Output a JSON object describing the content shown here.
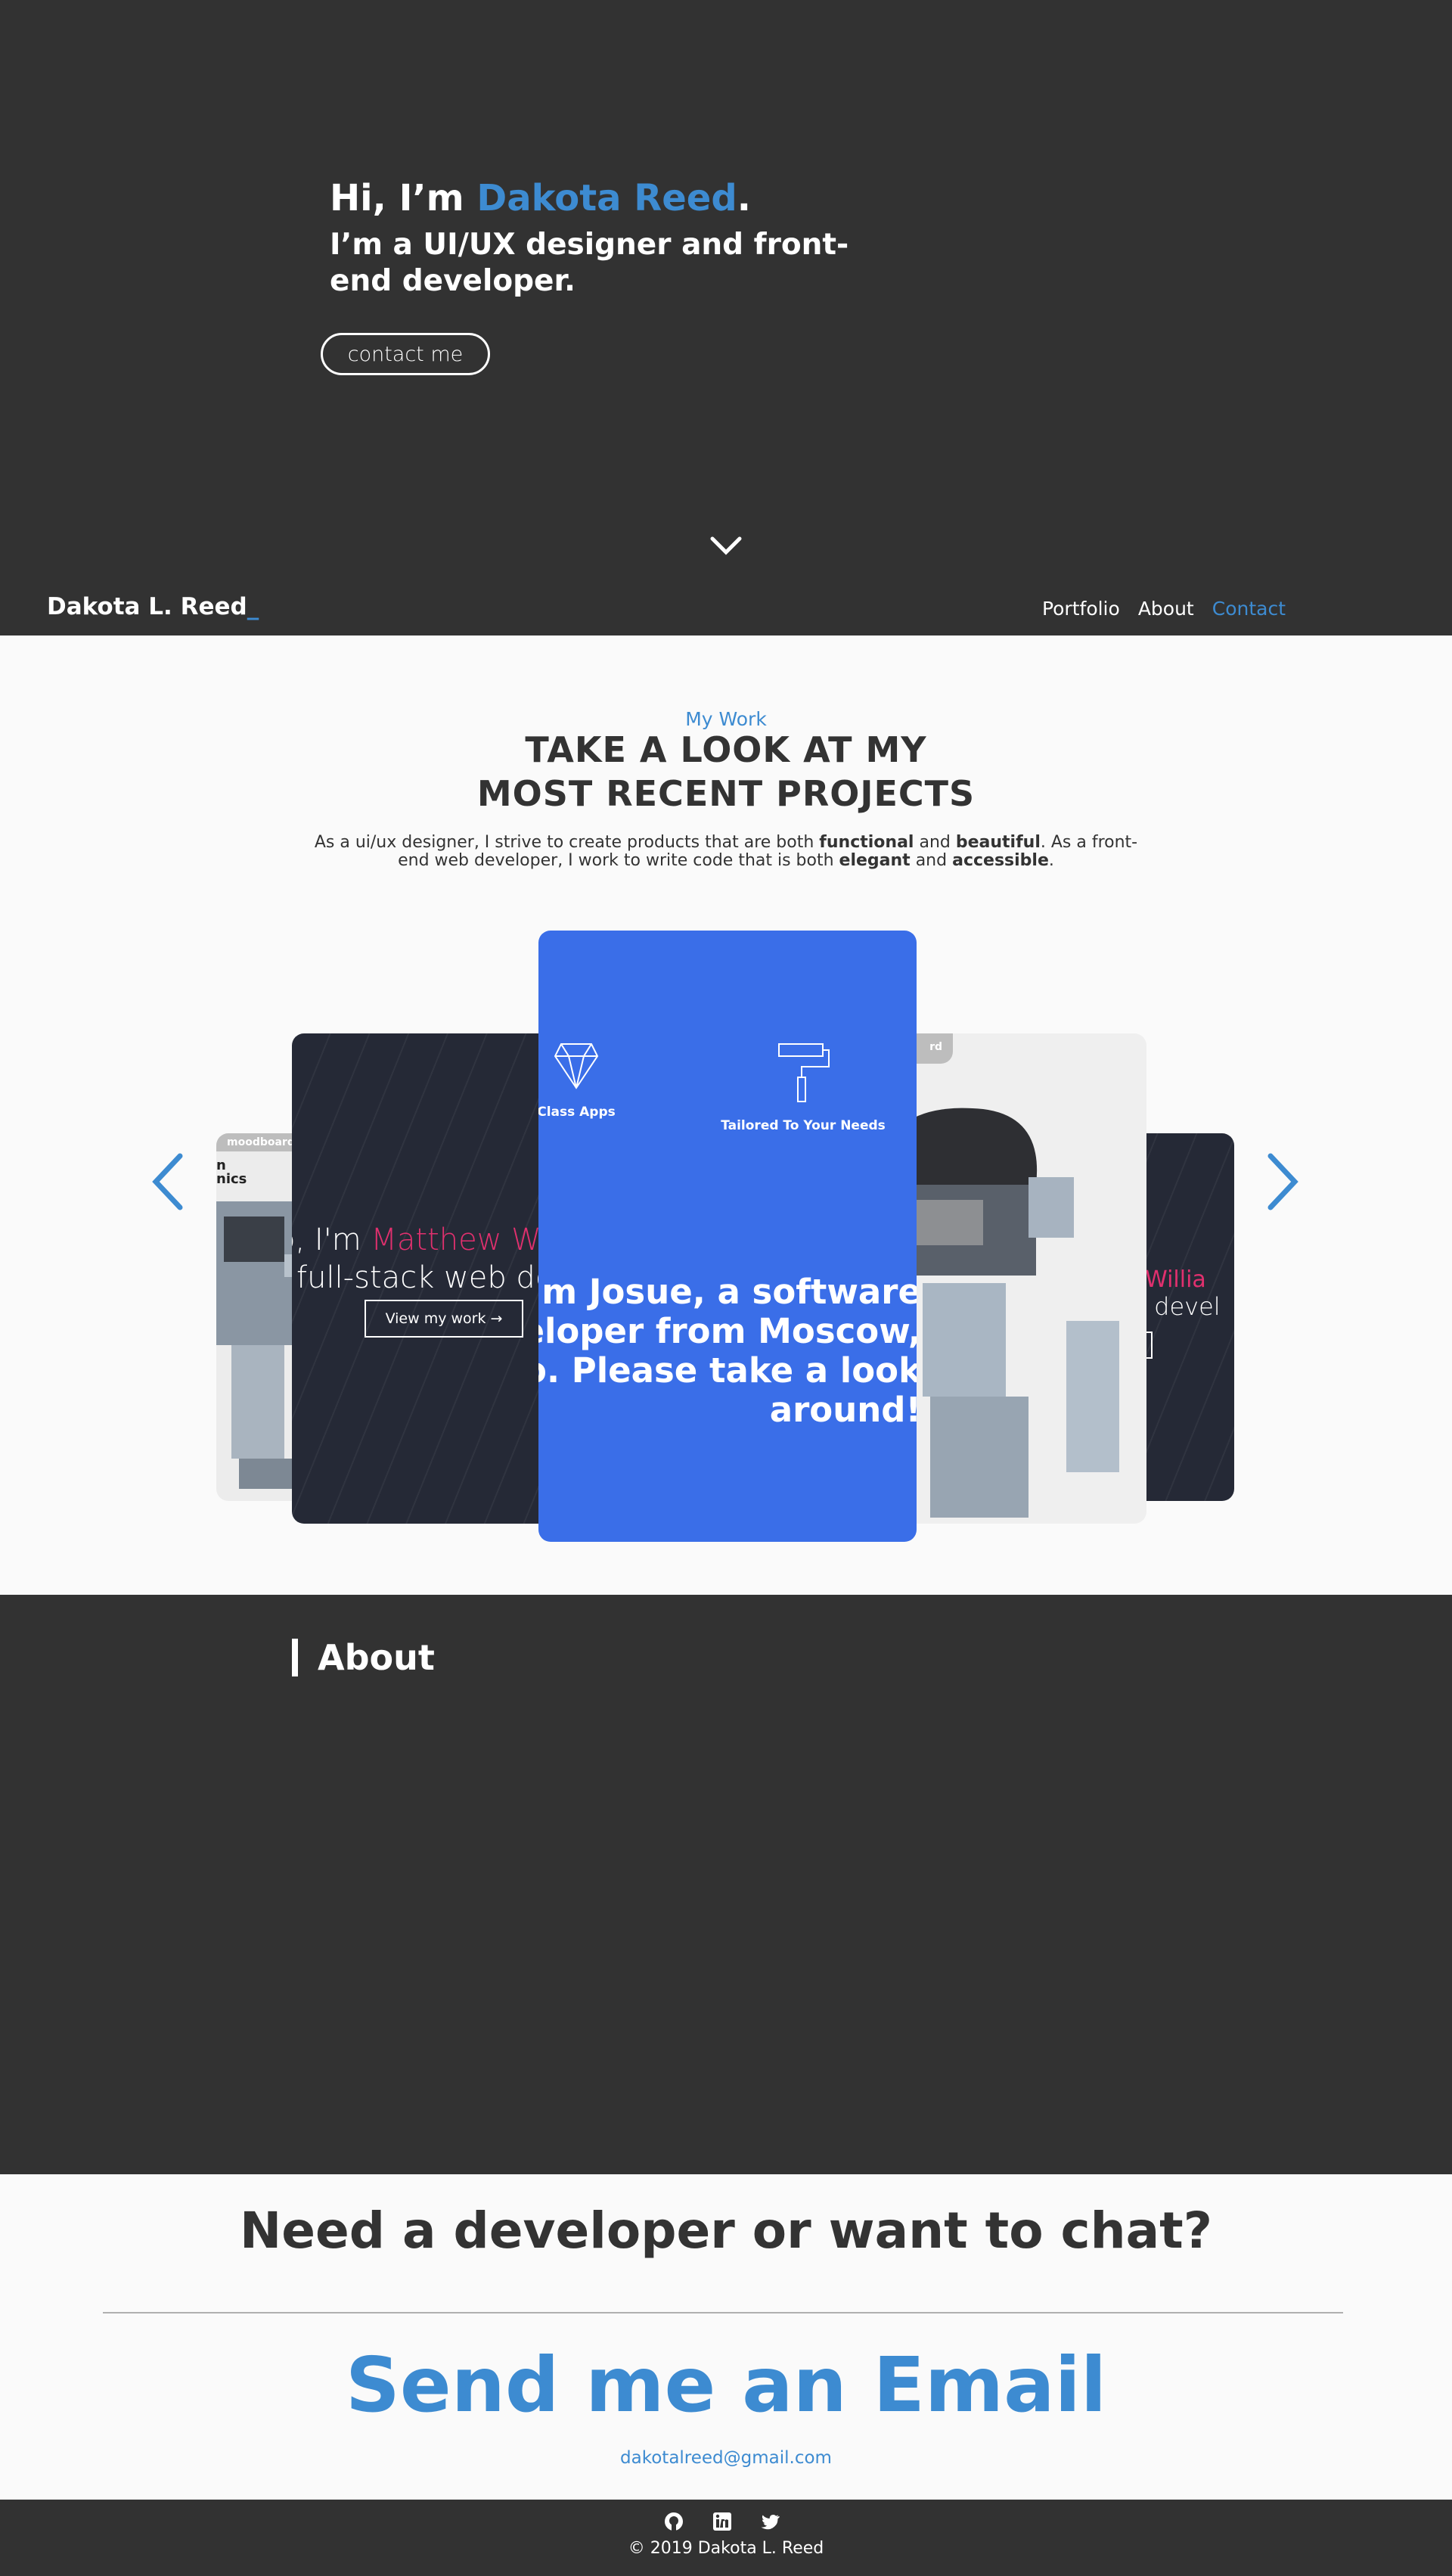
{
  "hero": {
    "greeting_prefix": "Hi, I’m ",
    "name": "Dakota Reed",
    "greeting_suffix": ".",
    "subtitle": "I’m a UI/UX designer and front-end developer.",
    "contact_button": "contact me"
  },
  "nav": {
    "brand": "Dakota L. Reed",
    "brand_cursor": "_",
    "links": [
      "Portfolio",
      "About",
      "Contact"
    ],
    "active": "Contact"
  },
  "work": {
    "eyebrow": "My Work",
    "title_line1": "TAKE A LOOK AT MY",
    "title_line2": "MOST RECENT PROJECTS",
    "desc": {
      "p1": "As a ui/ux designer, I strive to create products that are both ",
      "b1": "functional",
      "p2": " and ",
      "b2": "beautiful",
      "p3": ". As a front-end web developer, I work to write code that is both ",
      "b3": "elegant",
      "p4": " and ",
      "b4": "accessible",
      "p5": "."
    }
  },
  "carousel": {
    "far_left": {
      "tag": "moodboard",
      "label_line1": "n",
      "label_line2": "nics"
    },
    "left": {
      "line1_prefix": "o, I'm ",
      "line1_name": "Matthew W",
      "line2": "full-stack web de",
      "button": "View my work",
      "button_arrow": "→"
    },
    "center": {
      "feature1": "Class Apps",
      "feature2": "Tailored To Your Needs",
      "intro_line1": "I’m Josue, a software",
      "intro_line2": "veloper from Moscow,",
      "intro_line3": "ho. Please take a look",
      "intro_line4": "around!"
    },
    "right": {
      "tag": "rd"
    },
    "far_right": {
      "name": "w Willia",
      "line2": "eb devel",
      "button": "k →"
    }
  },
  "about": {
    "title": "About"
  },
  "contact": {
    "headline": "Need a developer or want to chat?",
    "cta": "Send me an Email",
    "email": "dakotalreed@gmail.com"
  },
  "footer": {
    "copyright": "© 2019 Dakota L. Reed",
    "social_icons": [
      "github-icon",
      "linkedin-icon",
      "twitter-icon"
    ]
  },
  "colors": {
    "dark_bg": "#323232",
    "accent_blue": "#3d8bd1",
    "card_blue": "#3a6ee8",
    "pink": "#e0306e",
    "light_bg": "#fafafa"
  }
}
